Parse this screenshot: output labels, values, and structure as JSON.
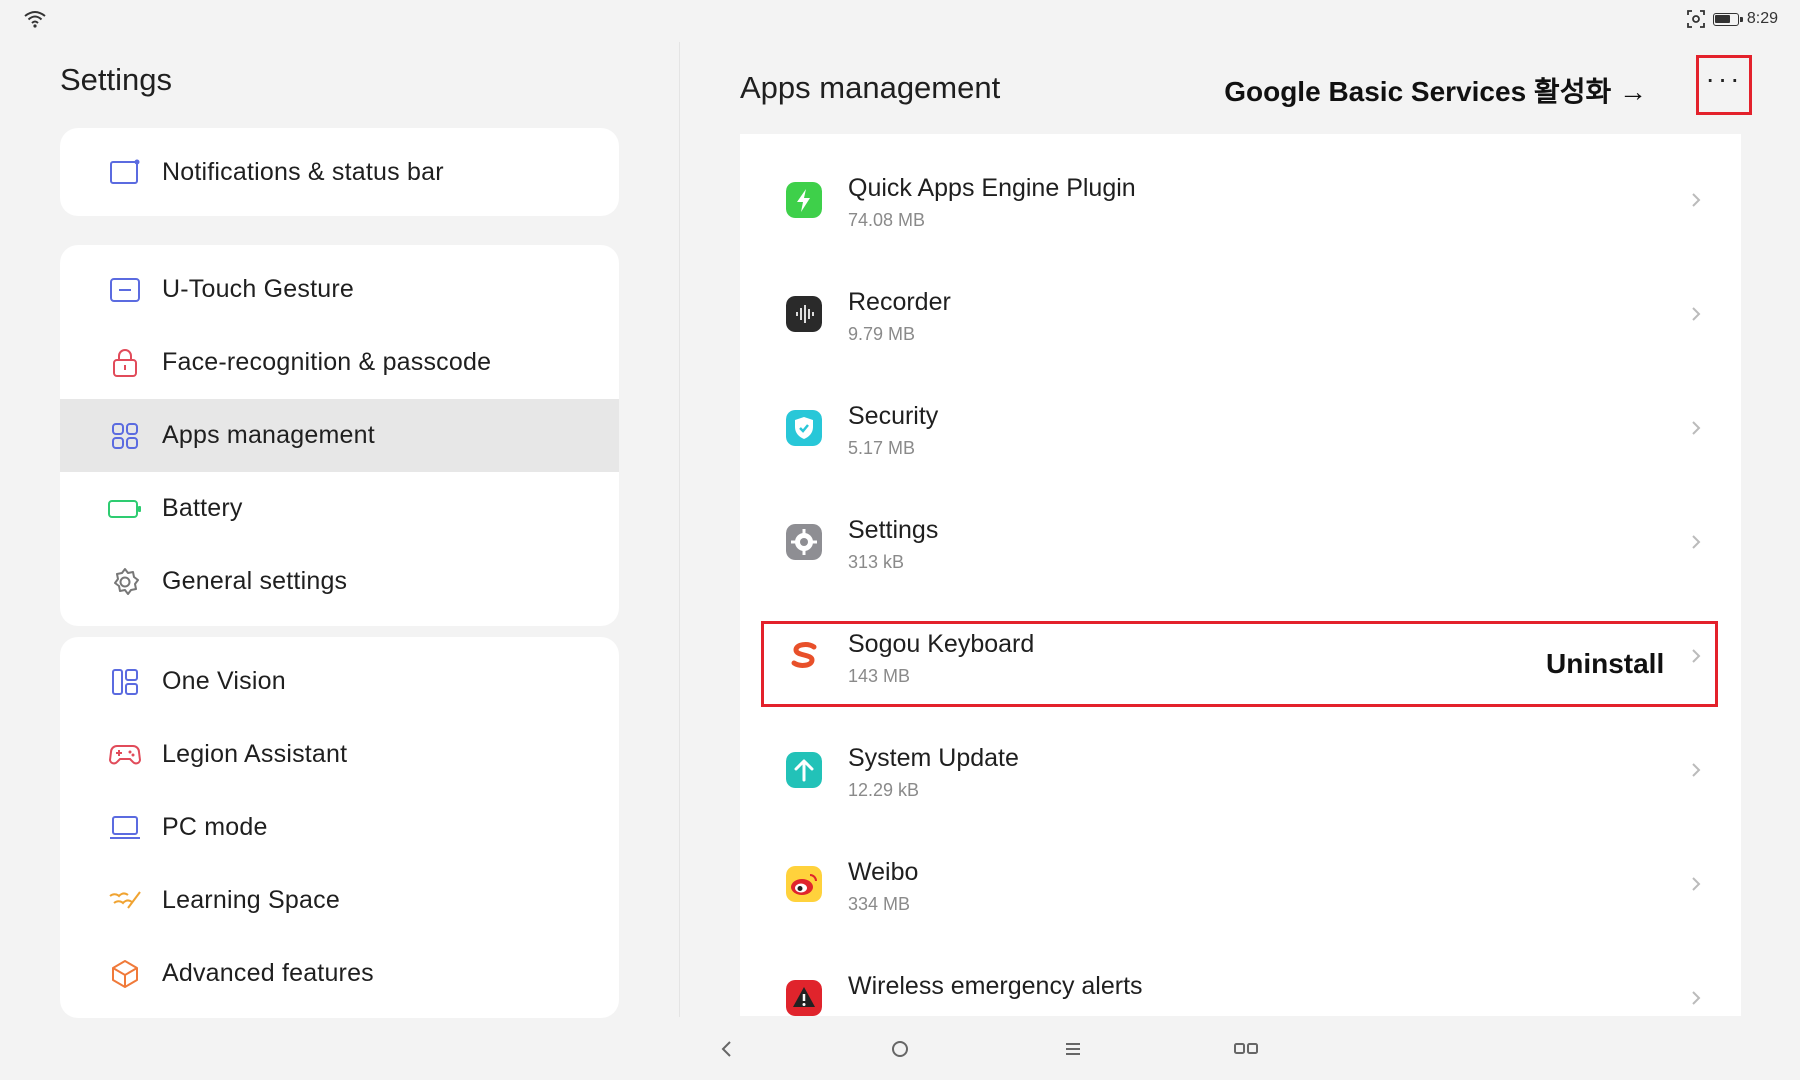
{
  "status_bar": {
    "time": "8:29",
    "icons": [
      "wifi-icon",
      "screenshot-icon",
      "battery-icon"
    ]
  },
  "sidebar": {
    "title": "Settings",
    "groups": [
      {
        "items": [
          {
            "label": "Notifications & status bar",
            "icon": "notification-icon"
          }
        ]
      },
      {
        "items": [
          {
            "label": "U-Touch Gesture",
            "icon": "gesture-icon"
          },
          {
            "label": "Face-recognition & passcode",
            "icon": "lock-icon"
          },
          {
            "label": "Apps management",
            "icon": "apps-grid-icon",
            "selected": true
          },
          {
            "label": "Battery",
            "icon": "battery-icon"
          },
          {
            "label": "General settings",
            "icon": "gear-icon"
          }
        ]
      },
      {
        "items": [
          {
            "label": "One Vision",
            "icon": "one-vision-icon"
          },
          {
            "label": "Legion Assistant",
            "icon": "gamepad-icon"
          },
          {
            "label": "PC mode",
            "icon": "laptop-icon"
          },
          {
            "label": "Learning Space",
            "icon": "learning-space-icon"
          },
          {
            "label": "Advanced features",
            "icon": "advanced-features-icon"
          }
        ]
      }
    ]
  },
  "main": {
    "title": "Apps management",
    "annotation": "Google Basic Services 활성화 →",
    "more_label": "···",
    "uninstall_annotation": "Uninstall",
    "apps": [
      {
        "name": "Quick Apps Engine Plugin",
        "size": "74.08 MB",
        "icon": "quick-apps-icon"
      },
      {
        "name": "Recorder",
        "size": "9.79 MB",
        "icon": "recorder-icon"
      },
      {
        "name": "Security",
        "size": "5.17 MB",
        "icon": "security-shield-icon"
      },
      {
        "name": "Settings",
        "size": "313 kB",
        "icon": "settings-gear-icon"
      },
      {
        "name": "Sogou Keyboard",
        "size": "143 MB",
        "icon": "sogou-icon"
      },
      {
        "name": "System Update",
        "size": "12.29 kB",
        "icon": "system-update-icon"
      },
      {
        "name": "Weibo",
        "size": "334 MB",
        "icon": "weibo-icon"
      },
      {
        "name": "Wireless emergency alerts",
        "size": "",
        "icon": "alert-icon"
      }
    ]
  },
  "navbar": {
    "buttons": [
      "back-icon",
      "home-icon",
      "menu-icon",
      "recents-icon"
    ]
  },
  "colors": {
    "highlight": "#e3212b",
    "selected_bg": "#e7e7e7",
    "card_bg": "#ffffff",
    "page_bg": "#f3f3f3"
  }
}
